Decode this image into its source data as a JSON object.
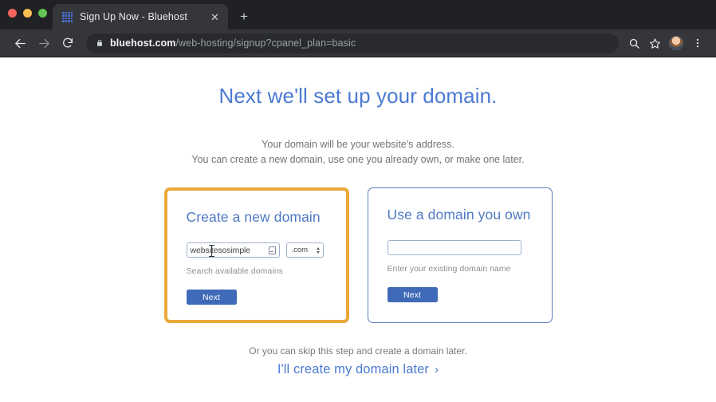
{
  "browser": {
    "window_controls": [
      "close",
      "minimize",
      "maximize"
    ],
    "tab": {
      "title": "Sign Up Now - Bluehost",
      "favicon_name": "bluehost-grid-favicon",
      "close_label": "✕"
    },
    "new_tab_label": "+",
    "nav": {
      "back_label": "←",
      "forward_label": "→",
      "reload_label": "↻"
    },
    "url": {
      "domain": "bluehost.com",
      "path": "/web-hosting/signup?cpanel_plan=basic",
      "lock_icon": "lock-icon"
    },
    "actions": {
      "search_icon": "search-icon",
      "bookmark_icon": "star-icon",
      "profile_icon": "avatar",
      "menu_icon": "three-dot-menu-icon"
    }
  },
  "page": {
    "headline": "Next we'll set up your domain.",
    "subtitle_line1": "Your domain will be your website's address.",
    "subtitle_line2": "You can create a new domain, use one you already own, or make one later.",
    "cards": [
      {
        "title": "Create a new domain",
        "input_value": "websitesosimple",
        "input_placeholder": "",
        "tld": ".com",
        "helper": "Search available domains",
        "button": "Next",
        "highlighted": true,
        "border_color": "#eba83a"
      },
      {
        "title": "Use a domain you own",
        "input_value": "",
        "input_placeholder": "",
        "helper": "Enter your existing domain name",
        "button": "Next",
        "highlighted": false,
        "border_color": "#5c7fc0"
      }
    ],
    "footer": {
      "skip_text": "Or you can skip this step and create a domain later.",
      "link_text": "I'll create my domain later",
      "link_chevron": "›"
    },
    "colors": {
      "heading_blue": "#4b7ad1",
      "card_title_blue": "#4f79c4",
      "button_blue": "#3f6ab8",
      "highlight_orange": "#eba83a",
      "input_border": "#9fb0cd"
    }
  }
}
